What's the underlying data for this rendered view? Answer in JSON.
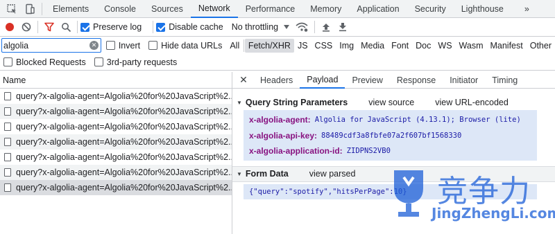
{
  "main_tabs": [
    {
      "label": "Elements"
    },
    {
      "label": "Console"
    },
    {
      "label": "Sources"
    },
    {
      "label": "Network"
    },
    {
      "label": "Performance"
    },
    {
      "label": "Memory"
    },
    {
      "label": "Application"
    },
    {
      "label": "Security"
    },
    {
      "label": "Lighthouse"
    }
  ],
  "more_tabs_label": "»",
  "toolbar": {
    "preserve_log": "Preserve log",
    "disable_cache": "Disable cache",
    "throttling": "No throttling"
  },
  "filter": {
    "value": "algolia",
    "invert": "Invert",
    "hide_data_urls": "Hide data URLs",
    "types": [
      "All",
      "Fetch/XHR",
      "JS",
      "CSS",
      "Img",
      "Media",
      "Font",
      "Doc",
      "WS",
      "Wasm",
      "Manifest",
      "Other"
    ]
  },
  "blocked": {
    "blocked_requests": "Blocked Requests",
    "third_party": "3rd-party requests"
  },
  "request_list": {
    "header": "Name",
    "rows": [
      "query?x-algolia-agent=Algolia%20for%20JavaScript%2...",
      "query?x-algolia-agent=Algolia%20for%20JavaScript%2...",
      "query?x-algolia-agent=Algolia%20for%20JavaScript%2...",
      "query?x-algolia-agent=Algolia%20for%20JavaScript%2...",
      "query?x-algolia-agent=Algolia%20for%20JavaScript%2...",
      "query?x-algolia-agent=Algolia%20for%20JavaScript%2...",
      "query?x-algolia-agent=Algolia%20for%20JavaScript%2..."
    ]
  },
  "detail_tabs": [
    "Headers",
    "Payload",
    "Preview",
    "Response",
    "Initiator",
    "Timing"
  ],
  "payload": {
    "qs_title": "Query String Parameters",
    "view_source": "view source",
    "view_url_encoded": "view URL-encoded",
    "params": [
      {
        "key": "x-algolia-agent:",
        "value": "Algolia for JavaScript (4.13.1); Browser (lite)"
      },
      {
        "key": "x-algolia-api-key:",
        "value": "88489cdf3a8fbfe07a2f607bf1568330"
      },
      {
        "key": "x-algolia-application-id:",
        "value": "ZIDPNS2VB0"
      }
    ],
    "fd_title": "Form Data",
    "view_parsed": "view parsed",
    "form_data": "{\"query\":\"spotify\",\"hitsPerPage\":10}"
  },
  "watermark": {
    "chinese": "竞争力",
    "domain": "JingZhengLi.com"
  },
  "colors": {
    "accent": "#1a73e8",
    "record": "#d93025",
    "filter_icon": "#d93025",
    "key": "#881280",
    "value": "#1a1aa6",
    "highlight": "#dde7f7",
    "watermark": "#1d5fd8"
  }
}
